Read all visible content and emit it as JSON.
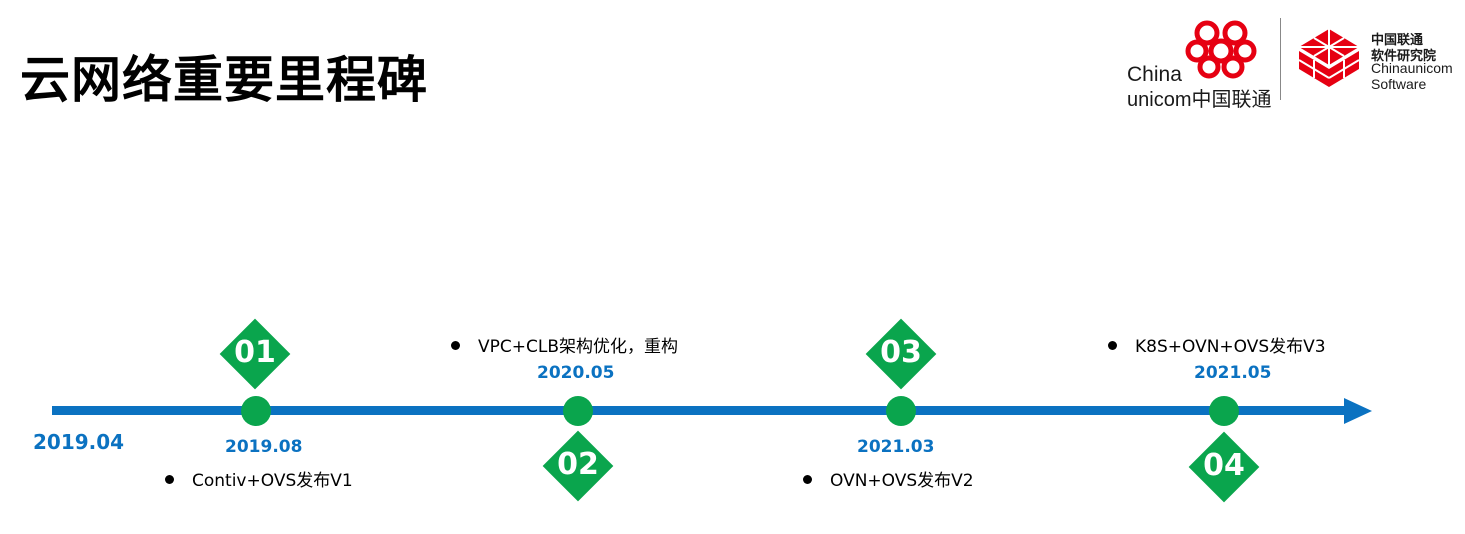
{
  "title": "云网络重要里程碑",
  "logo_left": {
    "line1": "China",
    "line2": "unicom中国联通"
  },
  "logo_right": {
    "line1": "中国联通",
    "line2": "软件研究院",
    "line3": "Chinaunicom",
    "line4": "Software"
  },
  "timeline": {
    "start": "2019.04",
    "milestones": [
      {
        "number": "01",
        "date": "2019.08",
        "text": "Contiv+OVS发布V1"
      },
      {
        "number": "02",
        "date": "2020.05",
        "text": "VPC+CLB架构优化，重构"
      },
      {
        "number": "03",
        "date": "2021.03",
        "text": "OVN+OVS发布V2"
      },
      {
        "number": "04",
        "date": "2021.05",
        "text": "K8S+OVN+OVS发布V3"
      }
    ]
  },
  "colors": {
    "axis": "#0b72c1",
    "milestone": "#0aa54d",
    "brand_red": "#e60012"
  }
}
